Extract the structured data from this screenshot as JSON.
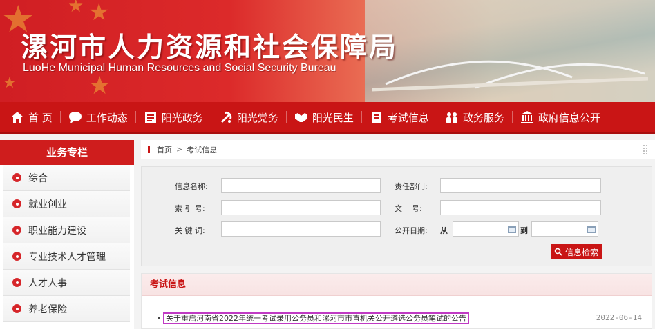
{
  "header": {
    "title": "漯河市人力资源和社会保障局",
    "subtitle": "LuoHe Municipal Human Resources and Social Security Bureau"
  },
  "nav": {
    "items": [
      {
        "label": "首 页",
        "icon": "home-icon"
      },
      {
        "label": "工作动态",
        "icon": "chat-bubble-icon"
      },
      {
        "label": "阳光政务",
        "icon": "document-list-icon"
      },
      {
        "label": "阳光党务",
        "icon": "party-emblem-icon"
      },
      {
        "label": "阳光民生",
        "icon": "handshake-icon"
      },
      {
        "label": "考试信息",
        "icon": "exam-paper-icon"
      },
      {
        "label": "政务服务",
        "icon": "people-icon"
      },
      {
        "label": "政府信息公开",
        "icon": "government-building-icon"
      }
    ]
  },
  "sidebar": {
    "title": "业务专栏",
    "items": [
      "综合",
      "就业创业",
      "职业能力建设",
      "专业技术人才管理",
      "人才人事",
      "养老保险"
    ]
  },
  "breadcrumb": {
    "home": "首页",
    "separator": ">",
    "current": "考试信息"
  },
  "search": {
    "name_label": "信息名称:",
    "dept_label": "责任部门:",
    "index_label": "索 引 号:",
    "doc_label": "文    号:",
    "keyword_label": "关 键 词:",
    "date_label": "公开日期:",
    "from_label": "从",
    "to_label": "到",
    "button_label": "信息检索"
  },
  "section": {
    "title": "考试信息",
    "items": [
      {
        "title": "关于重启河南省2022年统一考试录用公务员和漯河市市直机关公开遴选公务员笔试的公告",
        "date": "2022-06-14"
      }
    ]
  },
  "colors": {
    "primary_red": "#c91515",
    "highlight_border": "#c03ac4"
  }
}
